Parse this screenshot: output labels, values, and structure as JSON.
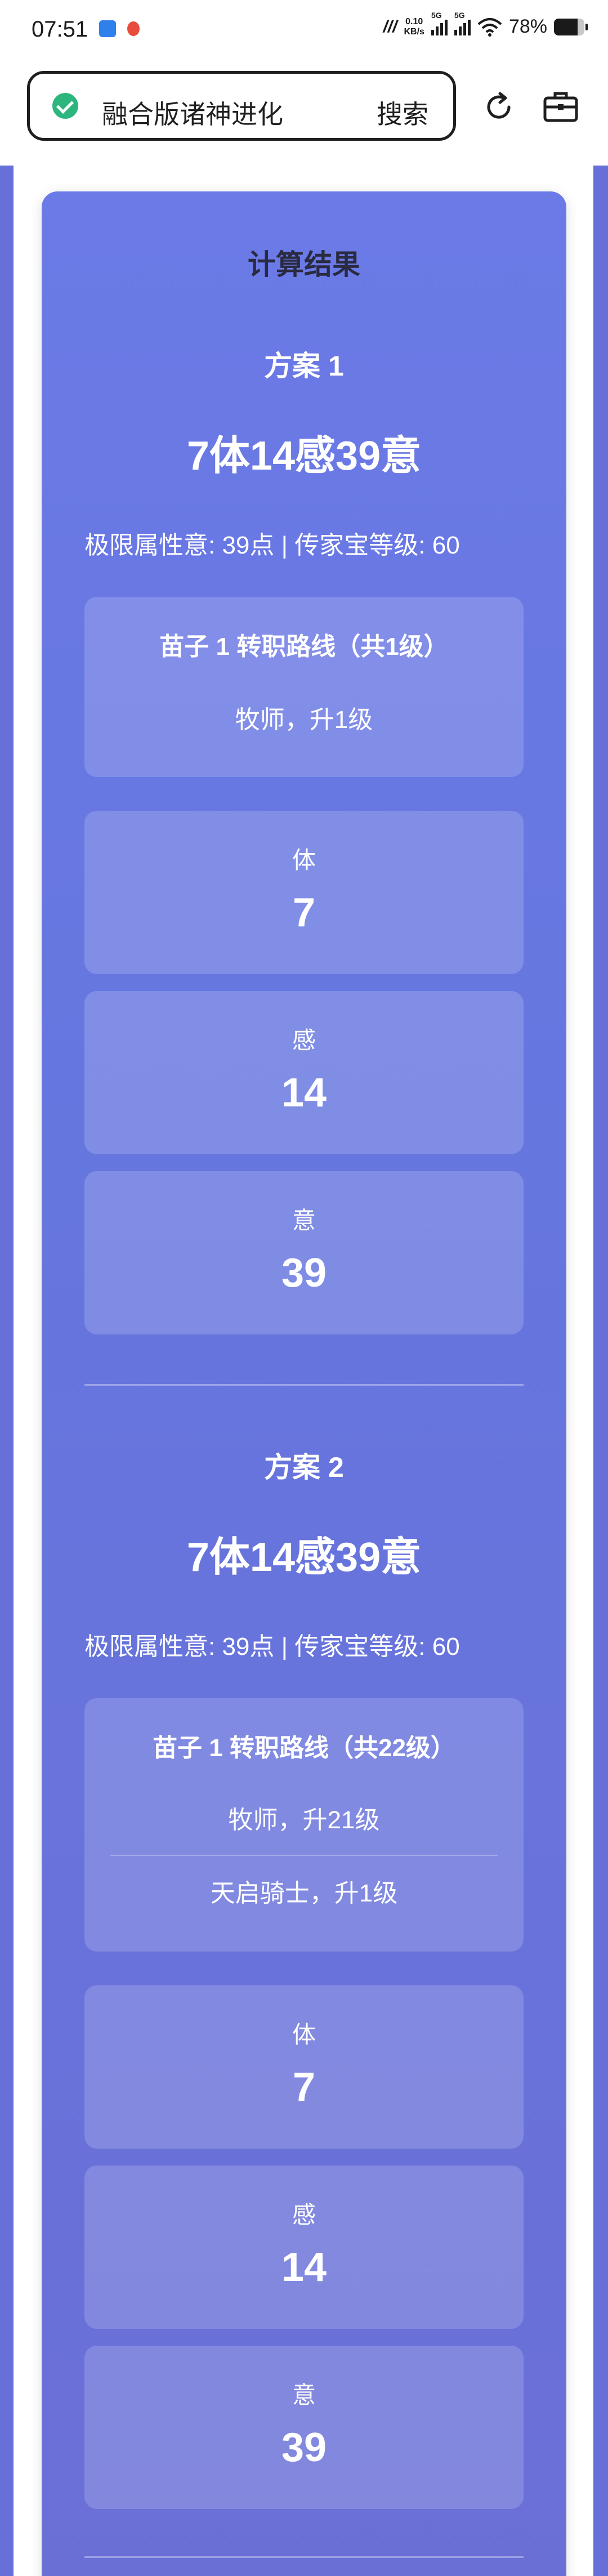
{
  "status_bar": {
    "time": "07:51",
    "net_speed_value": "0.10",
    "net_speed_unit": "KB/s",
    "signal1_label": "5G",
    "signal2_label": "5G",
    "battery": "78%"
  },
  "browser": {
    "search_text": "融合版诸神进化",
    "search_button": "搜索"
  },
  "results": {
    "title": "计算结果",
    "plans": [
      {
        "name": "方案 1",
        "summary": "7体14感39意",
        "info": "极限属性意: 39点 | 传家宝等级: 60",
        "path_title": "苗子 1 转职路线（共1级）",
        "path_steps": [
          "牧师，升1级"
        ],
        "stats": [
          {
            "label": "体",
            "value": "7"
          },
          {
            "label": "感",
            "value": "14"
          },
          {
            "label": "意",
            "value": "39"
          }
        ]
      },
      {
        "name": "方案 2",
        "summary": "7体14感39意",
        "info": "极限属性意: 39点 | 传家宝等级: 60",
        "path_title": "苗子 1 转职路线（共22级）",
        "path_steps": [
          "牧师，升21级",
          "天启骑士，升1级"
        ],
        "stats": [
          {
            "label": "体",
            "value": "7"
          },
          {
            "label": "感",
            "value": "14"
          },
          {
            "label": "意",
            "value": "39"
          }
        ]
      }
    ]
  }
}
